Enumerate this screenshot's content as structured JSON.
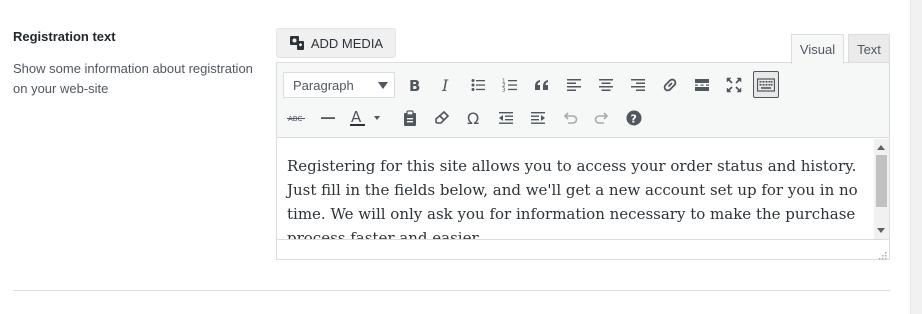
{
  "field": {
    "label": "Registration text",
    "description": "Show some information about registration on your web-site"
  },
  "media": {
    "add_media_label": "ADD MEDIA",
    "icon": "add-media-icon"
  },
  "tabs": [
    {
      "label": "Visual",
      "active": true
    },
    {
      "label": "Text",
      "active": false
    }
  ],
  "toolbar": {
    "format_select": {
      "value": "Paragraph"
    },
    "row1": [
      {
        "name": "bold",
        "icon": "bold-icon"
      },
      {
        "name": "italic",
        "icon": "italic-icon"
      },
      {
        "name": "bulleted-list",
        "icon": "bulleted-list-icon"
      },
      {
        "name": "numbered-list",
        "icon": "numbered-list-icon"
      },
      {
        "name": "blockquote",
        "icon": "blockquote-icon"
      },
      {
        "name": "align-left",
        "icon": "align-left-icon"
      },
      {
        "name": "align-center",
        "icon": "align-center-icon"
      },
      {
        "name": "align-right",
        "icon": "align-right-icon"
      },
      {
        "name": "insert-link",
        "icon": "link-icon"
      },
      {
        "name": "read-more",
        "icon": "read-more-icon"
      },
      {
        "name": "fullscreen",
        "icon": "fullscreen-icon"
      },
      {
        "name": "toolbar-toggle",
        "icon": "keyboard-icon",
        "active": true
      }
    ],
    "row2": [
      {
        "name": "strikethrough",
        "icon": "strikethrough-icon",
        "glyph": "ABC"
      },
      {
        "name": "horizontal-line",
        "icon": "horizontal-line-icon"
      },
      {
        "name": "text-color",
        "icon": "text-color-icon",
        "glyph": "A"
      },
      {
        "name": "paste-as-text",
        "icon": "clipboard-icon"
      },
      {
        "name": "clear-formatting",
        "icon": "eraser-icon"
      },
      {
        "name": "special-character",
        "icon": "omega-icon",
        "glyph": "Ω"
      },
      {
        "name": "outdent",
        "icon": "outdent-icon"
      },
      {
        "name": "indent",
        "icon": "indent-icon"
      },
      {
        "name": "undo",
        "icon": "undo-icon"
      },
      {
        "name": "redo",
        "icon": "redo-icon"
      },
      {
        "name": "keyboard-shortcuts",
        "icon": "help-icon",
        "glyph": "?"
      }
    ]
  },
  "editor": {
    "content": "Registering for this site allows you to access your order status and history. Just fill in the fields below, and we'll get a new account set up for you in no time. We will only ask you for information necessary to make the purchase process faster and easier."
  },
  "colors": {
    "background": "#ffffff",
    "toolbar_bg": "#f6f7f7",
    "border": "#dcdcde",
    "icon": "#50575e",
    "text": "#2c3338"
  }
}
